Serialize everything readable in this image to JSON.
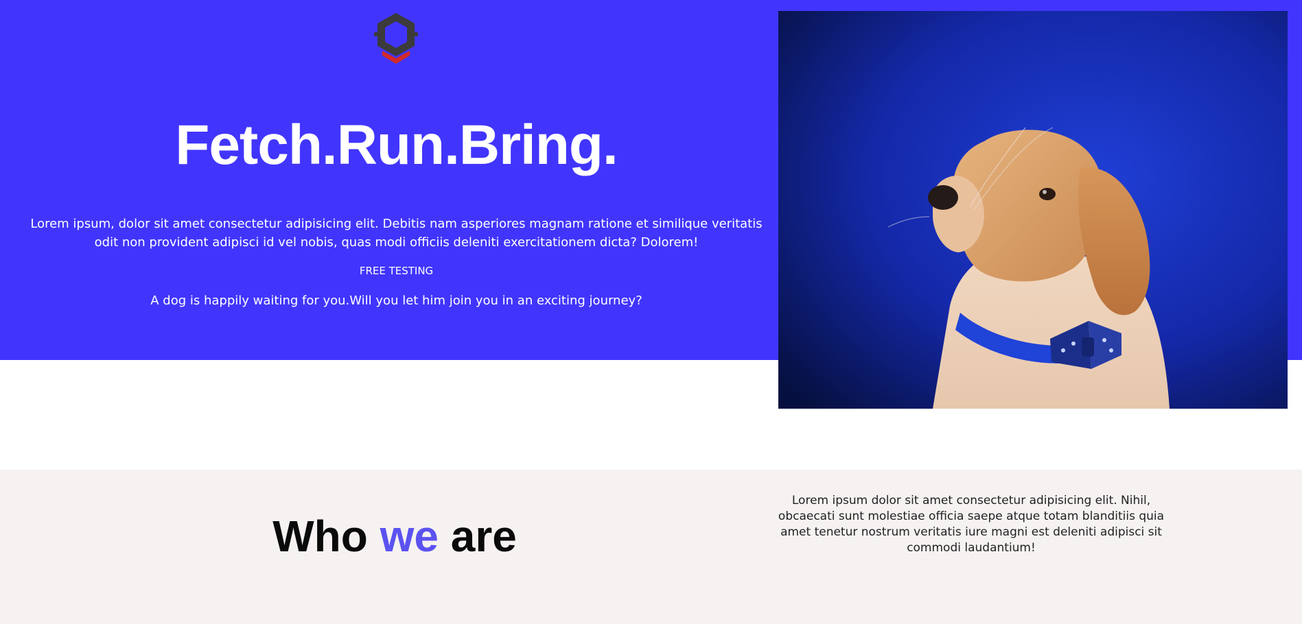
{
  "hero": {
    "logo_icon": "hexagon-chevron-logo-icon",
    "title": "Fetch.Run.Bring.",
    "intro": "Lorem ipsum, dolor sit amet consectetur adipisicing elit. Debitis nam asperiores magnam ratione et similique veritatis odit non provident adipisci id vel nobis, quas modi officiis deleniti exercitationem dicta? Dolorem!",
    "free_testing": "FREE TESTING",
    "tagline": "A dog is happily waiting for you.Will you let him join you in an exciting journey?",
    "photo": "puppy-with-bowtie-photo"
  },
  "about": {
    "title_part1": "Who ",
    "title_accent": "we",
    "title_part2": " are",
    "text": "Lorem ipsum dolor sit amet consectetur adipisicing elit. Nihil, obcaecati sunt molestiae officia saepe atque totam blanditiis quia amet tenetur nostrum veritatis iure magni est deleniti adipisci sit commodi laudantium!"
  },
  "colors": {
    "hero_background": "#4135fd",
    "accent": "#5b52f0",
    "about_background": "#f5f2f1",
    "logo_dark": "#3a3a3a",
    "logo_red": "#d22a2a"
  }
}
